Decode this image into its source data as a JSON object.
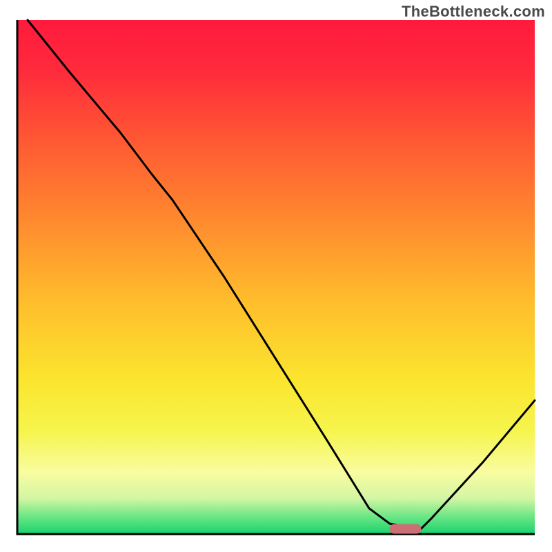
{
  "watermark": "TheBottleneck.com",
  "colors": {
    "curve": "#000000",
    "marker_fill": "#cc6f74",
    "gradient_stops": [
      {
        "offset": 0.0,
        "color": "#ff1a3c"
      },
      {
        "offset": 0.1,
        "color": "#ff2b3c"
      },
      {
        "offset": 0.24,
        "color": "#ff5a33"
      },
      {
        "offset": 0.4,
        "color": "#ff8d2e"
      },
      {
        "offset": 0.55,
        "color": "#ffbe2c"
      },
      {
        "offset": 0.7,
        "color": "#fbe52e"
      },
      {
        "offset": 0.8,
        "color": "#f6f54d"
      },
      {
        "offset": 0.88,
        "color": "#f9fca0"
      },
      {
        "offset": 0.93,
        "color": "#d4f6a4"
      },
      {
        "offset": 0.965,
        "color": "#6ee786"
      },
      {
        "offset": 1.0,
        "color": "#17d36e"
      }
    ]
  },
  "chart_data": {
    "type": "line",
    "title": "",
    "xlabel": "",
    "ylabel": "",
    "xlim": [
      0,
      100
    ],
    "ylim": [
      0,
      100
    ],
    "series": [
      {
        "name": "bottleneck-curve",
        "x": [
          2,
          10,
          20,
          26,
          30,
          40,
          50,
          60,
          68,
          72,
          78,
          80,
          90,
          100
        ],
        "y": [
          100,
          90,
          78,
          70,
          65,
          50,
          34,
          18,
          5,
          2,
          1,
          3,
          14,
          26
        ]
      }
    ],
    "marker": {
      "x": 75,
      "y": 1.0,
      "label": "optimal-point"
    },
    "notes": "x and y are visual percentages of the plot area (0 = left/bottom, 100 = right/top). Values estimated from pixel positions; the chart has no numeric axes."
  }
}
